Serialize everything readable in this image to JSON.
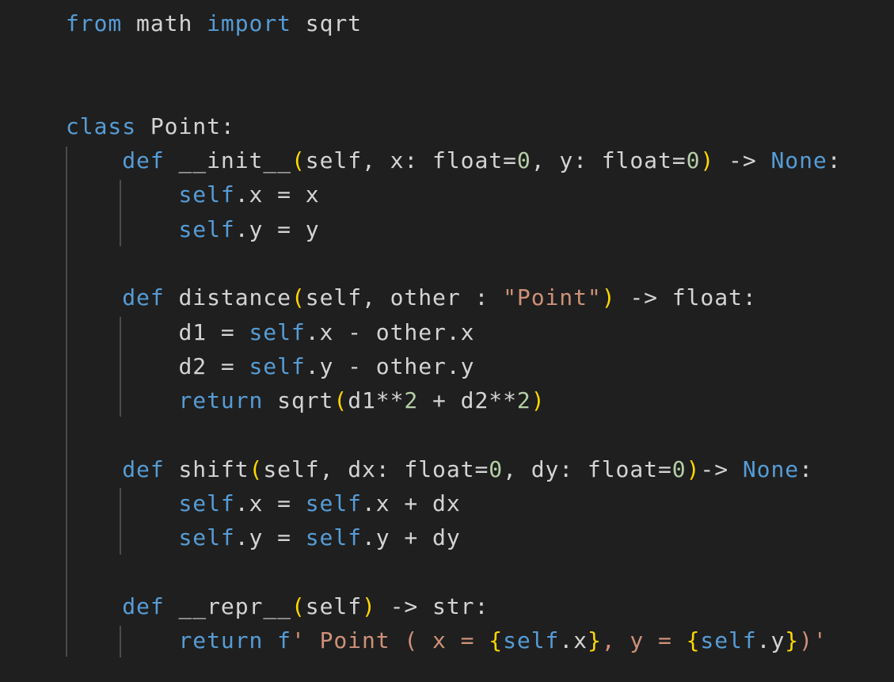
{
  "editor": {
    "language": "python",
    "colors": {
      "background": "#1f1f1f",
      "default": "#d4d4d4",
      "keyword": "#569cd6",
      "number": "#b5cea8",
      "string": "#ce9178",
      "bracket": "#ffd700",
      "indent_guide": "#4b4b4b"
    },
    "lines": [
      [
        {
          "t": "from",
          "k": "kw"
        },
        {
          "t": " math ",
          "k": "txt"
        },
        {
          "t": "import",
          "k": "kw"
        },
        {
          "t": " sqrt",
          "k": "txt"
        }
      ],
      [],
      [],
      [
        {
          "t": "class",
          "k": "kw"
        },
        {
          "t": " Point:",
          "k": "txt"
        }
      ],
      [
        {
          "t": "    ",
          "k": "txt"
        },
        {
          "t": "def",
          "k": "kw"
        },
        {
          "t": " __init__",
          "k": "txt"
        },
        {
          "t": "(",
          "k": "b1"
        },
        {
          "t": "self, x: float=",
          "k": "txt"
        },
        {
          "t": "0",
          "k": "num"
        },
        {
          "t": ", y: float=",
          "k": "txt"
        },
        {
          "t": "0",
          "k": "num"
        },
        {
          "t": ")",
          "k": "b1"
        },
        {
          "t": " -> ",
          "k": "txt"
        },
        {
          "t": "None",
          "k": "const"
        },
        {
          "t": ":",
          "k": "txt"
        }
      ],
      [
        {
          "t": "        ",
          "k": "txt"
        },
        {
          "t": "self",
          "k": "self"
        },
        {
          "t": ".x = x",
          "k": "txt"
        }
      ],
      [
        {
          "t": "        ",
          "k": "txt"
        },
        {
          "t": "self",
          "k": "self"
        },
        {
          "t": ".y = y",
          "k": "txt"
        }
      ],
      [],
      [
        {
          "t": "    ",
          "k": "txt"
        },
        {
          "t": "def",
          "k": "kw"
        },
        {
          "t": " distance",
          "k": "txt"
        },
        {
          "t": "(",
          "k": "b1"
        },
        {
          "t": "self, other : ",
          "k": "txt"
        },
        {
          "t": "\"Point\"",
          "k": "str"
        },
        {
          "t": ")",
          "k": "b1"
        },
        {
          "t": " -> float:",
          "k": "txt"
        }
      ],
      [
        {
          "t": "        d1 = ",
          "k": "txt"
        },
        {
          "t": "self",
          "k": "self"
        },
        {
          "t": ".x - other.x",
          "k": "txt"
        }
      ],
      [
        {
          "t": "        d2 = ",
          "k": "txt"
        },
        {
          "t": "self",
          "k": "self"
        },
        {
          "t": ".y - other.y",
          "k": "txt"
        }
      ],
      [
        {
          "t": "        ",
          "k": "txt"
        },
        {
          "t": "return",
          "k": "ctl"
        },
        {
          "t": " sqrt",
          "k": "txt"
        },
        {
          "t": "(",
          "k": "b1"
        },
        {
          "t": "d1**",
          "k": "txt"
        },
        {
          "t": "2",
          "k": "num"
        },
        {
          "t": " + d2**",
          "k": "txt"
        },
        {
          "t": "2",
          "k": "num"
        },
        {
          "t": ")",
          "k": "b1"
        }
      ],
      [],
      [
        {
          "t": "    ",
          "k": "txt"
        },
        {
          "t": "def",
          "k": "kw"
        },
        {
          "t": " shift",
          "k": "txt"
        },
        {
          "t": "(",
          "k": "b1"
        },
        {
          "t": "self, dx: float=",
          "k": "txt"
        },
        {
          "t": "0",
          "k": "num"
        },
        {
          "t": ", dy: float=",
          "k": "txt"
        },
        {
          "t": "0",
          "k": "num"
        },
        {
          "t": ")",
          "k": "b1"
        },
        {
          "t": "-> ",
          "k": "txt"
        },
        {
          "t": "None",
          "k": "const"
        },
        {
          "t": ":",
          "k": "txt"
        }
      ],
      [
        {
          "t": "        ",
          "k": "txt"
        },
        {
          "t": "self",
          "k": "self"
        },
        {
          "t": ".x = ",
          "k": "txt"
        },
        {
          "t": "self",
          "k": "self"
        },
        {
          "t": ".x + dx",
          "k": "txt"
        }
      ],
      [
        {
          "t": "        ",
          "k": "txt"
        },
        {
          "t": "self",
          "k": "self"
        },
        {
          "t": ".y = ",
          "k": "txt"
        },
        {
          "t": "self",
          "k": "self"
        },
        {
          "t": ".y + dy",
          "k": "txt"
        }
      ],
      [],
      [
        {
          "t": "    ",
          "k": "txt"
        },
        {
          "t": "def",
          "k": "kw"
        },
        {
          "t": " __repr__",
          "k": "txt"
        },
        {
          "t": "(",
          "k": "b1"
        },
        {
          "t": "self",
          "k": "txt"
        },
        {
          "t": ")",
          "k": "b1"
        },
        {
          "t": " -> str:",
          "k": "txt"
        }
      ],
      [
        {
          "t": "        ",
          "k": "txt"
        },
        {
          "t": "return",
          "k": "ctl"
        },
        {
          "t": " f",
          "k": "kw"
        },
        {
          "t": "' Point ( x = ",
          "k": "str"
        },
        {
          "t": "{",
          "k": "b1"
        },
        {
          "t": "self",
          "k": "self"
        },
        {
          "t": ".x",
          "k": "txt"
        },
        {
          "t": "}",
          "k": "b1"
        },
        {
          "t": ", y = ",
          "k": "str"
        },
        {
          "t": "{",
          "k": "b1"
        },
        {
          "t": "self",
          "k": "self"
        },
        {
          "t": ".y",
          "k": "txt"
        },
        {
          "t": "}",
          "k": "b1"
        },
        {
          "t": ")'",
          "k": "str"
        }
      ]
    ]
  }
}
